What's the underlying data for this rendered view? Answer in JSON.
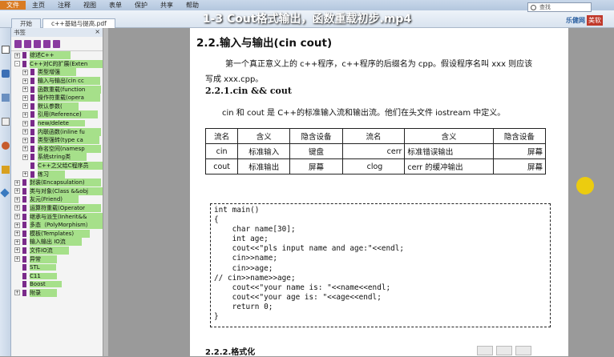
{
  "video_title": "1-3 Cout格式输出，函数重载初步.mp4",
  "menu": [
    "文件",
    "主页",
    "注释",
    "视图",
    "表单",
    "保护",
    "共享",
    "帮助"
  ],
  "tabs": [
    "开始",
    "c++基础与提高.pdf"
  ],
  "search_placeholder": "查找",
  "brand": {
    "left": "乐健网",
    "right": "美软"
  },
  "bookmarks_title": "书签",
  "bookmarks": [
    {
      "t": "综述C++",
      "lvl": 1,
      "ex": "+"
    },
    {
      "t": "C++对C的扩展(Exten",
      "lvl": 1,
      "ex": "-"
    },
    {
      "t": "类型增强",
      "lvl": 2,
      "ex": "+"
    },
    {
      "t": "输入与输出(cin cc",
      "lvl": 2,
      "ex": "+"
    },
    {
      "t": "函数重载(function",
      "lvl": 2,
      "ex": "+"
    },
    {
      "t": "操作符重载(opera",
      "lvl": 2,
      "ex": "+"
    },
    {
      "t": "默认参数(",
      "lvl": 2,
      "ex": "+"
    },
    {
      "t": "引用(Reference)",
      "lvl": 2,
      "ex": "+"
    },
    {
      "t": "new/delete",
      "lvl": 2,
      "ex": "+"
    },
    {
      "t": "内联函数(inline fu",
      "lvl": 2,
      "ex": "+"
    },
    {
      "t": "类型强转(type ca",
      "lvl": 2,
      "ex": "+"
    },
    {
      "t": "命名空间(namesp",
      "lvl": 2,
      "ex": "+"
    },
    {
      "t": "系统string类",
      "lvl": 2,
      "ex": "+"
    },
    {
      "t": "C++之父给C程序员",
      "lvl": 2,
      "ex": ""
    },
    {
      "t": "练习",
      "lvl": 2,
      "ex": "+"
    },
    {
      "t": "封装(Encapsulation)",
      "lvl": 1,
      "ex": "+"
    },
    {
      "t": "类与对象(Class &&obj",
      "lvl": 1,
      "ex": "+"
    },
    {
      "t": "友元(Friend)",
      "lvl": 1,
      "ex": "+"
    },
    {
      "t": "运算符重载(Operator",
      "lvl": 1,
      "ex": "+"
    },
    {
      "t": "继承与派生(Inherit&&",
      "lvl": 1,
      "ex": "+"
    },
    {
      "t": "多态（PolyMorphism）",
      "lvl": 1,
      "ex": "+"
    },
    {
      "t": "模板(Templates)",
      "lvl": 1,
      "ex": "+"
    },
    {
      "t": "输入输出 IO流",
      "lvl": 1,
      "ex": "+"
    },
    {
      "t": "文件IO流",
      "lvl": 1,
      "ex": "+"
    },
    {
      "t": "异常",
      "lvl": 1,
      "ex": "+"
    },
    {
      "t": "STL",
      "lvl": 1,
      "ex": ""
    },
    {
      "t": "C11",
      "lvl": 1,
      "ex": ""
    },
    {
      "t": "Boost",
      "lvl": 1,
      "ex": ""
    },
    {
      "t": "附录",
      "lvl": 1,
      "ex": "+"
    }
  ],
  "doc": {
    "h2": "2.2.输入与输出(cin cout)",
    "p1": "第一个真正意义上的 c++程序，c++程序的后缀名为 cpp。假设程序名叫 xxx 则应该",
    "p2": "写成 xxx.cpp。",
    "h3": "2.2.1.cin && cout",
    "p3": "cin 和 cout 是 C++的标准输入流和输出流。他们在头文件 iostream 中定义。",
    "table": [
      [
        "流名",
        "含义",
        "隐含设备",
        "流名",
        "含义",
        "隐含设备"
      ],
      [
        "cin",
        "标准输入",
        "键盘",
        "cerr",
        "标准错误输出",
        "屏幕"
      ],
      [
        "cout",
        "标准输出",
        "屏幕",
        "clog",
        "cerr 的缓冲输出",
        "屏幕"
      ]
    ],
    "code": [
      "int main()",
      "{",
      "    char name[30];",
      "    int age;",
      "    cout<<\"pls input name and age:\"<<endl;",
      "    cin>>name;",
      "    cin>>age;",
      "// cin>>name>>age;",
      "    cout<<\"your name is: \"<<name<<endl;",
      "    cout<<\"your age is: \"<<age<<endl;",
      "    return 0;",
      "}"
    ],
    "h4": "2.2.2.格式化"
  }
}
